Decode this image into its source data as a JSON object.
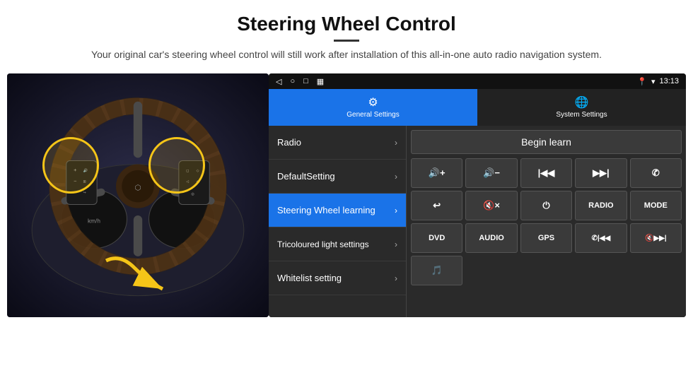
{
  "header": {
    "title": "Steering Wheel Control",
    "subtitle": "Your original car's steering wheel control will still work after installation of this all-in-one auto radio navigation system.",
    "divider": true
  },
  "status_bar": {
    "time": "13:13",
    "icons": [
      "◁",
      "○",
      "□",
      "▦"
    ]
  },
  "tabs": [
    {
      "label": "General Settings",
      "active": true
    },
    {
      "label": "System Settings",
      "active": false
    }
  ],
  "menu": {
    "items": [
      {
        "label": "Radio",
        "active": false
      },
      {
        "label": "DefaultSetting",
        "active": false
      },
      {
        "label": "Steering Wheel learning",
        "active": true
      },
      {
        "label": "Tricoloured light settings",
        "active": false
      },
      {
        "label": "Whitelist setting",
        "active": false
      }
    ]
  },
  "controls": {
    "begin_learn_label": "Begin learn",
    "row1": [
      {
        "symbol": "🔊+",
        "label": "vol-up"
      },
      {
        "symbol": "🔊−",
        "label": "vol-down"
      },
      {
        "symbol": "|◀◀",
        "label": "prev-track"
      },
      {
        "symbol": "▶▶|",
        "label": "next-track"
      },
      {
        "symbol": "✆",
        "label": "phone"
      }
    ],
    "row2": [
      {
        "symbol": "↩",
        "label": "hang-up"
      },
      {
        "symbol": "🔇×",
        "label": "mute"
      },
      {
        "symbol": "⏻",
        "label": "power"
      },
      {
        "symbol": "RADIO",
        "label": "radio"
      },
      {
        "symbol": "MODE",
        "label": "mode"
      }
    ],
    "row3": [
      {
        "symbol": "DVD",
        "label": "dvd"
      },
      {
        "symbol": "AUDIO",
        "label": "audio"
      },
      {
        "symbol": "GPS",
        "label": "gps"
      },
      {
        "symbol": "📞|◀◀",
        "label": "call-prev"
      },
      {
        "symbol": "🔇▶▶|",
        "label": "mute-next"
      }
    ],
    "row4_single": {
      "symbol": "🎵",
      "label": "whitelist-icon"
    }
  }
}
